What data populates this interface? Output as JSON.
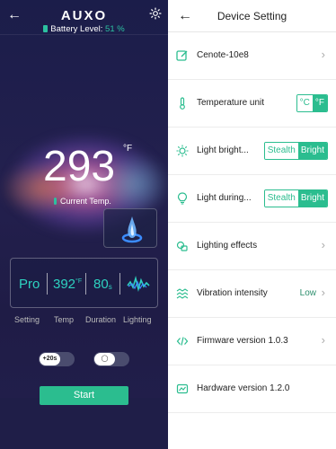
{
  "left": {
    "brand": "AUXO",
    "battery_label": "Battery Level:",
    "battery_pct": "51 %",
    "temp_value": "293",
    "temp_unit": "°F",
    "current_label": "Current Temp.",
    "settings": {
      "profile": "Pro",
      "temp": "392",
      "temp_unit": "°F",
      "duration": "80",
      "duration_unit": "s",
      "labels": [
        "Setting",
        "Temp",
        "Duration",
        "Lighting"
      ]
    },
    "boost_label": "+20s",
    "start_label": "Start",
    "colors": {
      "accent": "#2bbd8f",
      "bg": "#1f1c46"
    },
    "icons": [
      "back-arrow-icon",
      "gear-icon",
      "battery-icon",
      "thermometer-icon",
      "flame-icon",
      "wave-icon",
      "bulb-icon"
    ]
  },
  "right": {
    "title": "Device Setting",
    "rows": [
      {
        "label": "Cenote-10e8",
        "icon": "edit-icon"
      },
      {
        "label": "Temperature unit",
        "icon": "thermometer-icon",
        "options": [
          "°C",
          "°F"
        ],
        "selected": "°F"
      },
      {
        "label": "Light bright...",
        "icon": "sun-icon",
        "options": [
          "Stealth",
          "Bright"
        ],
        "selected": "Bright"
      },
      {
        "label": "Light during...",
        "icon": "bulb-icon",
        "options": [
          "Stealth",
          "Bright"
        ],
        "selected": "Bright"
      },
      {
        "label": "Lighting effects",
        "icon": "palette-icon"
      },
      {
        "label": "Vibration intensity",
        "icon": "vibration-icon",
        "value": "Low"
      },
      {
        "label": "Firmware version 1.0.3",
        "icon": "code-icon"
      },
      {
        "label": "Hardware version 1.2.0",
        "icon": "chip-icon"
      }
    ]
  }
}
